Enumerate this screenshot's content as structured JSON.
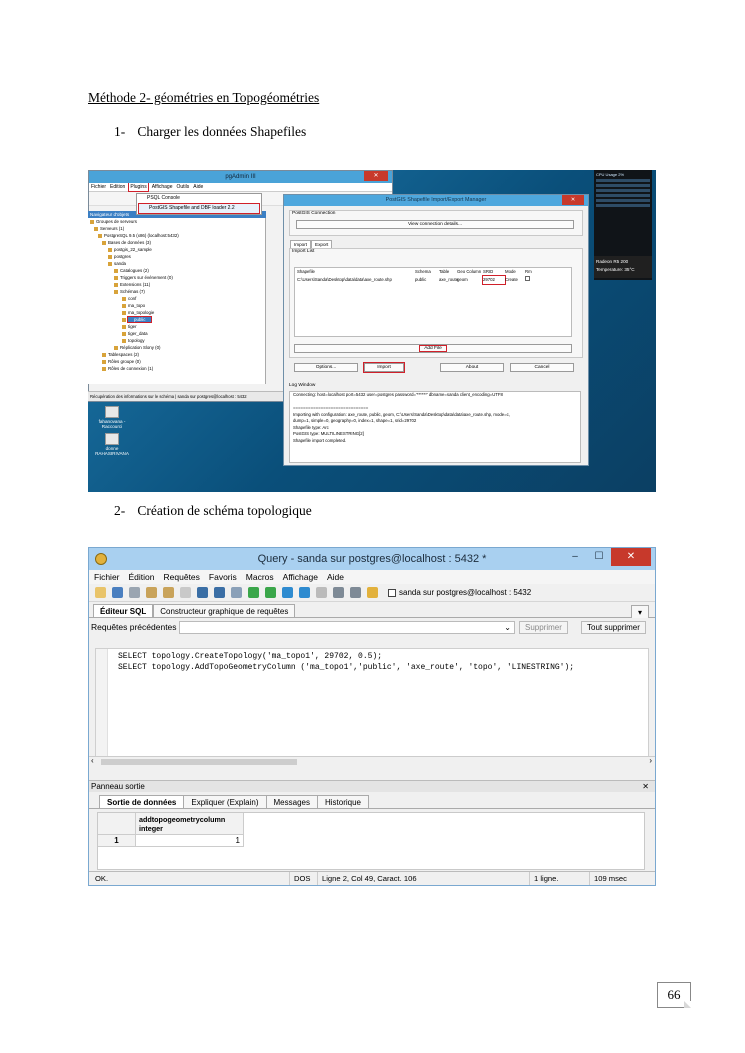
{
  "document": {
    "section_title": "Méthode 2- géométries en Topogéométries",
    "step1": {
      "number": "1-",
      "text": "Charger les données Shapefiles"
    },
    "step2": {
      "number": "2-",
      "text": "Création de schéma topologique"
    },
    "page_number": "66"
  },
  "screenshot1": {
    "pgadmin": {
      "title": "pgAdmin III",
      "close": "✕",
      "menu": [
        "Fichier",
        "Edition",
        "Plugins",
        "Affichage",
        "Outils",
        "Aide"
      ],
      "plugins_menu": [
        "PSQL Console",
        "PostGIS Shapefile and DBF loader 2.2"
      ],
      "tree_header": "Navigateur d'objets",
      "tree": [
        "Groupes de serveurs",
        "Serveurs (1)",
        "PostgreSQL 9.5 (x86) (localhost:5432)",
        "Bases de données (3)",
        "postgis_22_sample",
        "postgres",
        "sanda",
        "Catalogues (2)",
        "Triggers sur événement (0)",
        "Extensions (11)",
        "Schémas (7)",
        "conf",
        "ma_topo",
        "ma_topologie",
        "public",
        "tiger",
        "tiger_data",
        "topology",
        "Réplication Slony (0)",
        "Tablespaces (2)",
        "Rôles groupe (0)",
        "Rôles de connexion (1)"
      ],
      "status": "Récupération des informations sur le schéma | sanda sur postgres@localhost : 5432"
    },
    "desktop_icons": [
      "fahanovana - Raccourci",
      "donne RAHASIRIVANA"
    ],
    "loader": {
      "title": "PostGIS Shapefile Import/Export Manager",
      "connection_group": "PostGIS Connection",
      "view_connection_button": "View connection details...",
      "tabs": [
        "Import",
        "Export"
      ],
      "import_list_label": "Import List",
      "columns": [
        "Shapefile",
        "Schema",
        "Table",
        "Geo Column",
        "SRID",
        "Mode",
        "Rm"
      ],
      "row": [
        "C:\\Users\\Sanda\\Desktop\\data\\data\\axe_route.shp",
        "public",
        "axe_route",
        "geom",
        "29702",
        "Create",
        ""
      ],
      "add_file_button": "Add File",
      "options_button": "Options...",
      "import_button": "Import",
      "about_button": "About",
      "cancel_button": "Cancel",
      "log_label": "Log Window",
      "log": [
        "Connecting: host=localhost port=5432 user=postgres password='******' dbname=sanda client_encoding=UTF8",
        "",
        "==============================",
        "Importing with configuration: axe_route, public, geom, C:\\Users\\Sanda\\Desktop\\data\\data\\axe_route.shp, mode=c,",
        "dump=1, simple=0, geography=0, index=1, shape=1, srid=29702",
        "Shapefile type: Arc",
        "PostGIS type: MULTILINESTRING[2]",
        "Shapefile import completed."
      ]
    },
    "gadget": {
      "title": "CPU Usage 2%",
      "radeon": "Radeon R5 200",
      "temperature": "Temperature: 35°C"
    }
  },
  "screenshot2": {
    "title": "Query - sanda sur postgres@localhost : 5432 *",
    "window_buttons": [
      "–",
      "☐",
      "✕"
    ],
    "menu": [
      "Fichier",
      "Édition",
      "Requêtes",
      "Favoris",
      "Macros",
      "Affichage",
      "Aide"
    ],
    "connection": "sanda sur postgres@localhost : 5432",
    "tabs": [
      "Éditeur SQL",
      "Constructeur graphique de requêtes"
    ],
    "previous_queries_label": "Requêtes précédentes",
    "delete_button": "Supprimer",
    "delete_all_button": "Tout supprimer",
    "sql_lines": [
      "SELECT topology.CreateTopology('ma_topo1', 29702, 0.5);",
      "SELECT topology.AddTopoGeometryColumn ('ma_topo1','public', 'axe_route', 'topo', 'LINESTRING');"
    ],
    "output_panel_label": "Panneau sortie",
    "output_tabs": [
      "Sortie de données",
      "Expliquer (Explain)",
      "Messages",
      "Historique"
    ],
    "result": {
      "column": "addtopogeometrycolumn",
      "type": "integer",
      "row_number": "1",
      "value": "1"
    },
    "status": {
      "state": "OK.",
      "encoding": "DOS",
      "position": "Ligne 2, Col 49, Caract. 106",
      "rows": "1 ligne.",
      "time": "109 msec"
    }
  }
}
